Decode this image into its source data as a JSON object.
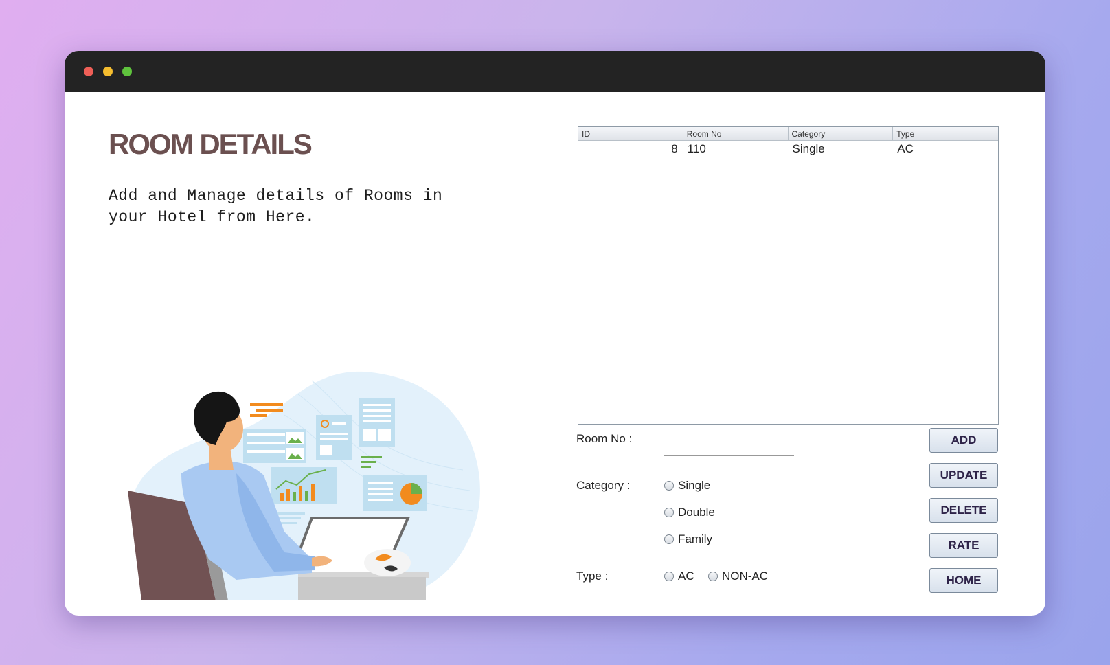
{
  "header": {
    "title": "ROOM DETAILS",
    "subtitle": "Add and Manage details of Rooms in your Hotel from Here."
  },
  "table": {
    "columns": [
      "ID",
      "Room No",
      "Category",
      "Type"
    ],
    "rows": [
      {
        "id": "8",
        "room_no": "110",
        "category": "Single",
        "type": "AC"
      }
    ]
  },
  "form": {
    "room_no_label": "Room No :",
    "room_no_value": "",
    "category_label": "Category :",
    "category_options": [
      "Single",
      "Double",
      "Family"
    ],
    "type_label": "Type :",
    "type_options": [
      "AC",
      "NON-AC"
    ]
  },
  "buttons": {
    "add": "ADD",
    "update": "UPDATE",
    "delete": "DELETE",
    "rate": "RATE",
    "home": "HOME"
  },
  "colors": {
    "title": "#6b5050",
    "titlebar": "#232323",
    "button_text": "#2e2348",
    "illustration_accent": "#f28b1e"
  }
}
